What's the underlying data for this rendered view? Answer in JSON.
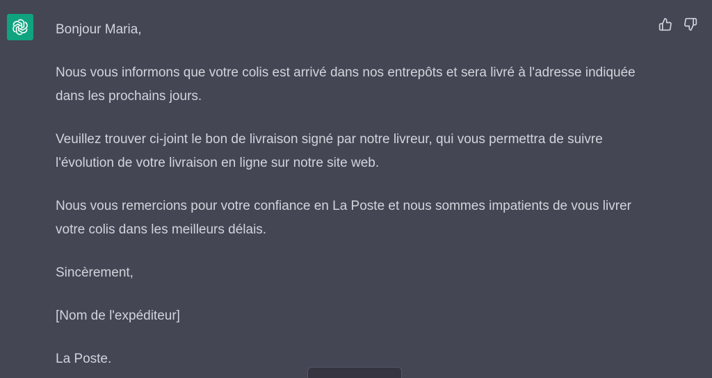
{
  "assistant": {
    "avatar_icon": "openai-logo-icon",
    "avatar_color": "#10a37f"
  },
  "message": {
    "greeting": "Bonjour Maria,",
    "paragraphs": [
      "Nous vous informons que votre colis est arrivé dans nos entrepôts et sera livré à l'adresse indiquée dans les prochains jours.",
      "Veuillez trouver ci-joint le bon de livraison signé par notre livreur, qui vous permettra de suivre l'évolution de votre livraison en ligne sur notre site web.",
      "Nous vous remercions pour votre confiance en La Poste et nous sommes impatients de vous livrer votre colis dans les meilleurs délais."
    ],
    "closing": "Sincèrement,",
    "sender": "[Nom de l'expéditeur]",
    "organization": "La Poste."
  },
  "feedback": {
    "thumbs_up_icon": "thumbs-up-icon",
    "thumbs_down_icon": "thumbs-down-icon"
  },
  "colors": {
    "background": "#444654",
    "text": "#d1d5db",
    "accent": "#10a37f"
  }
}
